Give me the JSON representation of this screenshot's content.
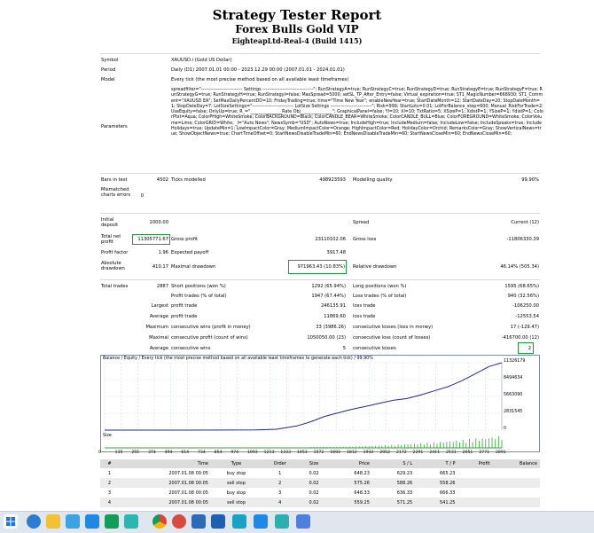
{
  "header": {
    "title": "Strategy Tester Report",
    "ea_name": "Forex Bulls Gold VIP",
    "server": "EighteapLtd-Real-4 (Build 1415)"
  },
  "info": {
    "symbol_label": "Symbol",
    "symbol": "XAUUSD.i (Gold US Dollar)",
    "period_label": "Period",
    "period": "Daily (D1) 2007.01.01 00:00 - 2023.12.29 00:00 (2007.01.01 - 2024.01.01)",
    "model_label": "Model",
    "model": "Every tick (the most precise method based on all available least timeframes)",
    "params_label": "Parameters",
    "params_text": "spreadfilter=\"--------------------------- Settings ---------------------------------\"; RunStrategyA=true; RunStrategyC=true; RunStrategyD=true; RunStrategyE=true; RunStrategyF=true; RunStrategyG=true; RunStrategyH=true; RunStrategyI=false; MaxSpread=5000; setSL_TP_After_Entry=false; Virtual_expiration=true; ST1_MagicNumber=668930; ST1_Comment=\"XAUUSD EA\"; SetMaxDailyPercentDD=10; FridayTrading=true; time=\"Time New Year\"; enableNewYear=true; StartDateMonth=12; StartDateDay=20; StopDateMonth=1; StopDateDay=7; LotSizeSettings=\"--------------------------- LotSize Settings ---------------------------\"; Risk=999; StartLots=0.01; LotForBalance_step=600; Manual_RiskForTrade=2; UseEquity=false; OnlyUp=true; R_=\"_______________Rate Obj_______________\"; GraphicalPanel=false; Yl=10; Xl=10; TxtRatio=5; XSizeP=1; XdistP=1; YSizeP=1; YdistP=1; ColorPtxt=Aqua; ColorPHigh=WhiteSmoke; ColorBACKGROUND=Black; ColorCANDLE_BEAR=WhiteSmoke; ColorCANDLE_BULL=Blue; ColorFOREGROUND=WhiteSmoke; ColorVolume=Lime; ColorGRID=White; _l=\"Auto News\"; NewsSymb=\"USD\"; AutoNews=true; IncludeHigh=true; IncludeMedium=false; IncludeLow=false; IncludeSpeaks=true; IncludeHolidays=true; UpdateMin=1; LowImpactColor=Gray; MediumImpactColor=Orange; HighImpactColor=Red; HolidayColor=Orchid; RemarksColor=Gray; ShowVerticalNews=true; ShowObjectNews=true; ChartTimeOffset=0; StartNewsDisableTradeMin=60; EndNewsDisableTradeMin=60; StartNewsCloseMin=60; EndNewsCloseMin=60;"
  },
  "stats": {
    "bars_label": "Bars in test",
    "bars": "4502",
    "ticks_label": "Ticks modelled",
    "ticks": "498923593",
    "quality_label": "Modelling quality",
    "quality": "99.90%",
    "mismatch_label": "Mismatched charts errors",
    "mismatch": "0",
    "deposit_label": "Initial deposit",
    "deposit": "1000.00",
    "spread_label": "Spread",
    "spread": "Current (12)",
    "net_label": "Total net profit",
    "net": "11305771.67",
    "gross_profit_label": "Gross profit",
    "gross_profit": "23110102.06",
    "gross_loss_label": "Gross loss",
    "gross_loss": "-11806330.39",
    "pf_label": "Profit factor",
    "pf": "1.96",
    "payoff_label": "Expected payoff",
    "payoff": "3917.48",
    "abs_dd_label": "Absolute drawdown",
    "abs_dd": "410.17",
    "max_dd_label": "Maximal drawdown",
    "max_dd": "971963.43 (10.83%)",
    "rel_dd_label": "Relative drawdown",
    "rel_dd": "46.14% (505.34)",
    "total_label": "Total trades",
    "total": "2887",
    "short_label": "Short positions (won %)",
    "short": "1292 (65.94%)",
    "long_label": "Long positions (won %)",
    "long": "1595 (68.65%)",
    "pt_label": "Profit trades (% of total)",
    "pt": "1947 (67.44%)",
    "lt_label": "Loss trades (% of total)",
    "lt": "940 (32.56%)",
    "largest_label": "Largest",
    "largest_profit_label": "profit trade",
    "largest_profit": "246135.91",
    "largest_loss_label": "loss trade",
    "largest_loss": "-106250.00",
    "average_label": "Average",
    "avg_profit_label": "profit trade",
    "avg_profit": "11869.60",
    "avg_loss_label": "loss trade",
    "avg_loss": "-12553.54",
    "maximum_label": "Maximum",
    "max_wins_label": "consecutive wins (profit in money)",
    "max_wins": "33 (3986.26)",
    "max_losses_label": "consecutive losses (loss in money)",
    "max_losses": "17 (-129.47)",
    "maximal_label": "Maximal",
    "maximal_profit_label": "consecutive profit (count of wins)",
    "maximal_profit": "1050050.00 (23)",
    "maximal_loss_label": "consecutive loss (count of losses)",
    "maximal_loss": "-416700.00 (12)",
    "average2_label": "Average",
    "avg_wins_label": "consecutive wins",
    "avg_wins": "5",
    "avg_losses_label": "consecutive losses",
    "avg_losses": "2"
  },
  "chart_data": {
    "type": "line",
    "caption": "Balance / Equity / Every tick (the most precise method based on all available least timeframes to generate each tick) / 99.90%",
    "size_label": "Size",
    "y_ticks": [
      "11326179",
      "8494634",
      "5663090",
      "2831545",
      "0"
    ],
    "x_ticks": [
      "0",
      "135",
      "255",
      "374",
      "494",
      "614",
      "734",
      "854",
      "974",
      "1093",
      "1213",
      "1333",
      "1453",
      "1572",
      "1692",
      "1812",
      "1932",
      "2052",
      "2172",
      "2291",
      "2411",
      "2531",
      "2651",
      "2771",
      "2891"
    ],
    "xlim": [
      0,
      2891
    ],
    "ylim": [
      0,
      11326179
    ],
    "series": [
      {
        "name": "Balance",
        "color": "#1f2a8f",
        "x": [
          0,
          300,
          600,
          900,
          1100,
          1250,
          1400,
          1500,
          1600,
          1700,
          1800,
          1900,
          2000,
          2100,
          2200,
          2300,
          2400,
          2500,
          2600,
          2700,
          2800,
          2891
        ],
        "values": [
          1000,
          1500,
          3000,
          8000,
          30000,
          150000,
          700000,
          1400000,
          2300000,
          2900000,
          3500000,
          4000000,
          4500000,
          5000000,
          5300000,
          5900000,
          6600000,
          7300000,
          8300000,
          9500000,
          10700000,
          11326179
        ]
      },
      {
        "name": "Equity",
        "color": "#2ea82e",
        "x": [
          0,
          2891
        ],
        "values": [
          1000,
          11326179
        ]
      }
    ],
    "legend": [
      "Balance",
      "Equity"
    ]
  },
  "trades": {
    "headers": [
      "#",
      "Time",
      "Type",
      "Order",
      "Size",
      "Price",
      "S / L",
      "T / P",
      "Profit",
      "Balance"
    ],
    "rows": [
      [
        "1",
        "2007.01.08 00:05",
        "buy stop",
        "1",
        "0.02",
        "648.23",
        "629.23",
        "665.23",
        "",
        ""
      ],
      [
        "2",
        "2007.01.08 00:05",
        "sell stop",
        "2",
        "0.02",
        "575.26",
        "588.26",
        "558.26",
        "",
        ""
      ],
      [
        "3",
        "2007.01.08 00:05",
        "buy stop",
        "3",
        "0.02",
        "648.33",
        "636.33",
        "666.33",
        "",
        ""
      ],
      [
        "4",
        "2007.01.08 00:05",
        "sell stop",
        "4",
        "0.02",
        "559.25",
        "571.25",
        "541.25",
        "",
        ""
      ]
    ]
  },
  "taskbar": {
    "icons": [
      "windows-start-icon",
      "search-icon",
      "taskview-icon",
      "edge-icon",
      "file-explorer-icon",
      "app-icon",
      "app-icon",
      "app-icon",
      "chrome-icon",
      "app-icon",
      "app-icon",
      "app-icon",
      "app-icon",
      "app-icon"
    ]
  }
}
